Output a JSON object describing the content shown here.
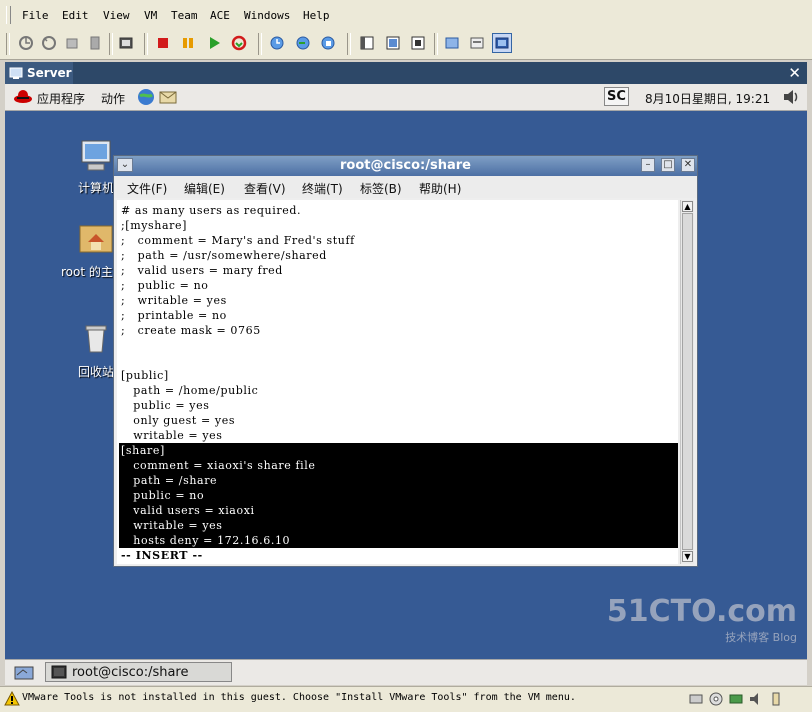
{
  "vm_menu": [
    {
      "label": "File"
    },
    {
      "label": "Edit"
    },
    {
      "label": "View"
    },
    {
      "label": "VM"
    },
    {
      "label": "Team"
    },
    {
      "label": "ACE"
    },
    {
      "label": "Windows"
    },
    {
      "label": "Help"
    }
  ],
  "vm_tab": {
    "label": "Server"
  },
  "gnome_panel": {
    "apps_label": "应用程序",
    "actions_label": "动作",
    "input_method": "SC",
    "clock": "8月10日星期日, 19:21"
  },
  "desktop_icons": [
    {
      "label": "计算机"
    },
    {
      "label": "root 的主目录"
    },
    {
      "label": "回收站"
    }
  ],
  "terminal": {
    "title": "root@cisco:/share",
    "menu": [
      "文件(F)",
      "编辑(E)",
      "查看(V)",
      "终端(T)",
      "标签(B)",
      "帮助(H)"
    ],
    "lines": [
      "# as many users as required.",
      ";[myshare]",
      ";   comment = Mary's and Fred's stuff",
      ";   path = /usr/somewhere/shared",
      ";   valid users = mary fred",
      ";   public = no",
      ";   writable = yes",
      ";   printable = no",
      ";   create mask = 0765",
      "",
      "",
      "[public]",
      "   path = /home/public",
      "   public = yes",
      "   only guest = yes",
      "   writable = yes",
      "[share]",
      "   comment = xiaoxi's share file",
      "   path = /share",
      "   public = no",
      "   valid users = xiaoxi",
      "   writable = yes",
      "   hosts deny = 172.16.6.10",
      "-- INSERT --"
    ],
    "highlight_start_index": 16,
    "highlight_end_index": 22
  },
  "taskbar": {
    "task_label": "root@cisco:/share"
  },
  "status_bar": {
    "message": "VMware Tools is not installed in this guest. Choose \"Install VMware Tools\" from the VM menu."
  },
  "watermark": {
    "main": "51CTO.com",
    "sub": "技术博客 Blog"
  },
  "colors": {
    "desktop": "#365a94",
    "highlight_bg": "#000000",
    "titlebar": "#4c6fa4"
  }
}
